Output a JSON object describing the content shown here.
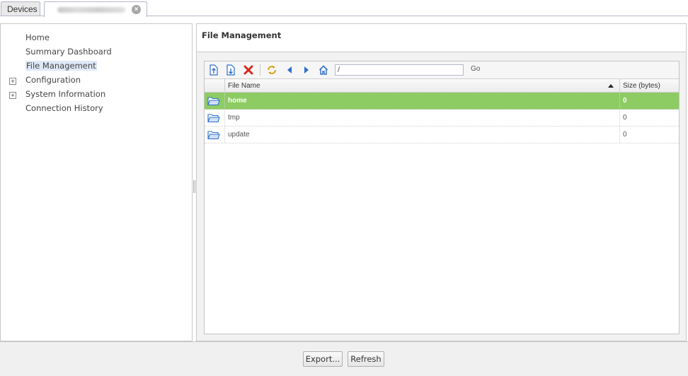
{
  "tabs": {
    "devices_label": "Devices"
  },
  "nav": {
    "items": [
      {
        "label": "Home"
      },
      {
        "label": "Summary Dashboard"
      },
      {
        "label": "File Management"
      },
      {
        "label": "Configuration",
        "expander": "+"
      },
      {
        "label": "System Information",
        "expander": "+"
      },
      {
        "label": "Connection History"
      }
    ]
  },
  "main": {
    "title": "File Management",
    "path_value": "/",
    "go_label": "Go",
    "columns": {
      "name": "File Name",
      "size": "Size (bytes)"
    },
    "rows": [
      {
        "name": "home",
        "size": "0",
        "selected": true
      },
      {
        "name": "tmp",
        "size": "0"
      },
      {
        "name": "update",
        "size": "0"
      }
    ]
  },
  "footer": {
    "export_label": "Export...",
    "refresh_label": "Refresh"
  },
  "colors": {
    "selection_green": "#8dcb63",
    "nav_selected_bg": "#dfe8f6",
    "icon_blue": "#2f6fc9",
    "delete_red": "#d9261c"
  }
}
